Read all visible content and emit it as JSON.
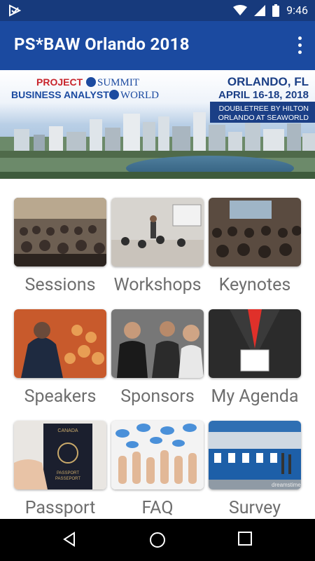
{
  "status_bar": {
    "time": "9:46"
  },
  "app_bar": {
    "title": "PS*BAW Orlando 2018"
  },
  "banner": {
    "line1_a": "PROJECT",
    "line1_b": "SUMMIT",
    "line2_a": "BUSINESS ANALYST",
    "line2_b": "WORLD",
    "city": "ORLANDO, FL",
    "dates": "APRIL 16-18, 2018",
    "venue_line1": "DOUBLETREE BY HILTON",
    "venue_line2": "ORLANDO AT SEAWORLD"
  },
  "tiles": [
    {
      "label": "Sessions"
    },
    {
      "label": "Workshops"
    },
    {
      "label": "Keynotes"
    },
    {
      "label": "Speakers"
    },
    {
      "label": "Sponsors"
    },
    {
      "label": "My Agenda"
    },
    {
      "label": "Passport"
    },
    {
      "label": "FAQ"
    },
    {
      "label": "Survey"
    }
  ],
  "thumbnail_watermark": "dreamstime",
  "passport": {
    "country": "CANADA",
    "word_en": "PASSPORT",
    "word_fr": "PASSEPORT"
  },
  "colors": {
    "status_bar": "#173a7c",
    "app_bar": "#1b4aa0",
    "label_text": "#6e6e6e",
    "accent_red": "#e0302a"
  }
}
